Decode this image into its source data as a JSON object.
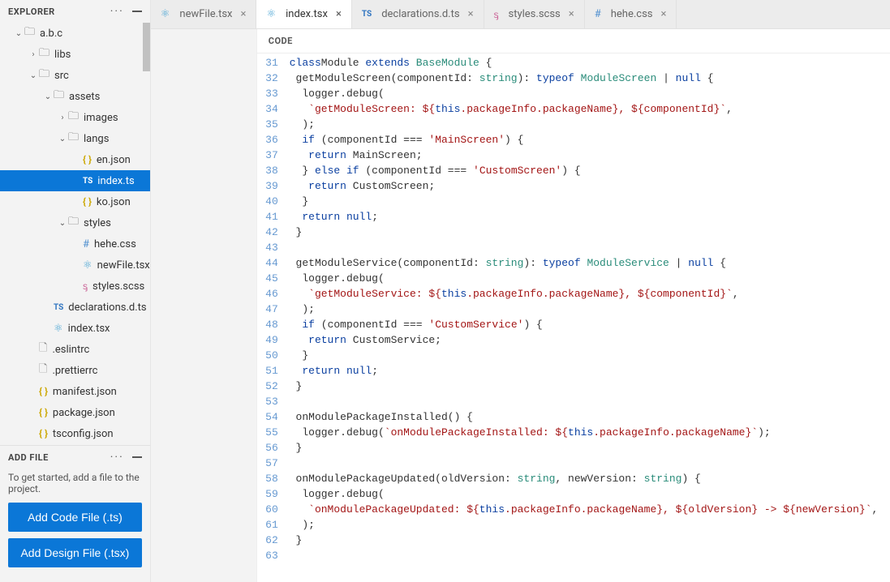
{
  "sidebar": {
    "title": "EXPLORER",
    "tree": [
      {
        "depth": 0,
        "chev": "down",
        "icon": "folder",
        "label": "a.b.c"
      },
      {
        "depth": 1,
        "chev": "right",
        "icon": "folder",
        "label": "libs"
      },
      {
        "depth": 1,
        "chev": "down",
        "icon": "folder",
        "label": "src"
      },
      {
        "depth": 2,
        "chev": "down",
        "icon": "folder",
        "label": "assets"
      },
      {
        "depth": 3,
        "chev": "right",
        "icon": "folder",
        "label": "images"
      },
      {
        "depth": 3,
        "chev": "down",
        "icon": "folder",
        "label": "langs"
      },
      {
        "depth": 4,
        "chev": "",
        "icon": "json",
        "label": "en.json"
      },
      {
        "depth": 4,
        "chev": "",
        "icon": "ts",
        "label": "index.ts",
        "selected": true
      },
      {
        "depth": 4,
        "chev": "",
        "icon": "json",
        "label": "ko.json"
      },
      {
        "depth": 3,
        "chev": "down",
        "icon": "folder",
        "label": "styles"
      },
      {
        "depth": 4,
        "chev": "",
        "icon": "hash",
        "label": "hehe.css"
      },
      {
        "depth": 4,
        "chev": "",
        "icon": "react",
        "label": "newFile.tsx"
      },
      {
        "depth": 4,
        "chev": "",
        "icon": "scss",
        "label": "styles.scss"
      },
      {
        "depth": 2,
        "chev": "",
        "icon": "ts",
        "label": "declarations.d.ts"
      },
      {
        "depth": 2,
        "chev": "",
        "icon": "react",
        "label": "index.tsx"
      },
      {
        "depth": 1,
        "chev": "",
        "icon": "file",
        "label": ".eslintrc"
      },
      {
        "depth": 1,
        "chev": "",
        "icon": "file",
        "label": ".prettierrc"
      },
      {
        "depth": 1,
        "chev": "",
        "icon": "json",
        "label": "manifest.json"
      },
      {
        "depth": 1,
        "chev": "",
        "icon": "json",
        "label": "package.json"
      },
      {
        "depth": 1,
        "chev": "",
        "icon": "json",
        "label": "tsconfig.json"
      }
    ],
    "addFile": {
      "title": "ADD FILE",
      "hint": "To get started, add a file to the project.",
      "codeBtn": "Add Code File (.ts)",
      "designBtn": "Add Design File (.tsx)"
    }
  },
  "tabs": [
    {
      "icon": "react",
      "label": "newFile.tsx",
      "active": false
    },
    {
      "icon": "react",
      "label": "index.tsx",
      "active": true
    },
    {
      "icon": "ts",
      "label": "declarations.d.ts",
      "active": false
    },
    {
      "icon": "scss",
      "label": "styles.scss",
      "active": false
    },
    {
      "icon": "hash",
      "label": "hehe.css",
      "active": false
    }
  ],
  "editor": {
    "header": "CODE",
    "startLine": 31,
    "lines": [
      [
        [
          "kw",
          "class"
        ],
        [
          "",
          ""
        ],
        [
          "",
          "Module "
        ],
        [
          "kw",
          "extends"
        ],
        [
          "",
          " "
        ],
        [
          "type",
          "BaseModule"
        ],
        [
          "",
          " {"
        ]
      ],
      [
        [
          "",
          " getModuleScreen(componentId: "
        ],
        [
          "type",
          "string"
        ],
        [
          "",
          "): "
        ],
        [
          "kw",
          "typeof"
        ],
        [
          "",
          " "
        ],
        [
          "type",
          "ModuleScreen"
        ],
        [
          "",
          " | "
        ],
        [
          "null",
          "null"
        ],
        [
          "",
          " {"
        ]
      ],
      [
        [
          "",
          "  logger.debug("
        ]
      ],
      [
        [
          "",
          "   "
        ],
        [
          "str",
          "`getModuleScreen: ${"
        ],
        [
          "this",
          "this"
        ],
        [
          "str",
          ".packageInfo.packageName}, ${componentId}`"
        ],
        [
          "",
          ","
        ]
      ],
      [
        [
          "",
          "  );"
        ]
      ],
      [
        [
          "",
          "  "
        ],
        [
          "kw",
          "if"
        ],
        [
          "",
          " (componentId === "
        ],
        [
          "str",
          "'MainScreen'"
        ],
        [
          "",
          ") {"
        ]
      ],
      [
        [
          "",
          "   "
        ],
        [
          "kw",
          "return"
        ],
        [
          "",
          " MainScreen;"
        ]
      ],
      [
        [
          "",
          "  } "
        ],
        [
          "kw",
          "else if"
        ],
        [
          "",
          " (componentId === "
        ],
        [
          "str",
          "'CustomScreen'"
        ],
        [
          "",
          ") {"
        ]
      ],
      [
        [
          "",
          "   "
        ],
        [
          "kw",
          "return"
        ],
        [
          "",
          " CustomScreen;"
        ]
      ],
      [
        [
          "",
          "  }"
        ]
      ],
      [
        [
          "",
          "  "
        ],
        [
          "kw",
          "return"
        ],
        [
          "",
          " "
        ],
        [
          "null",
          "null"
        ],
        [
          "",
          ";"
        ]
      ],
      [
        [
          "",
          " }"
        ]
      ],
      [
        [
          "",
          ""
        ]
      ],
      [
        [
          "",
          " getModuleService(componentId: "
        ],
        [
          "type",
          "string"
        ],
        [
          "",
          "): "
        ],
        [
          "kw",
          "typeof"
        ],
        [
          "",
          " "
        ],
        [
          "type",
          "ModuleService"
        ],
        [
          "",
          " | "
        ],
        [
          "null",
          "null"
        ],
        [
          "",
          " {"
        ]
      ],
      [
        [
          "",
          "  logger.debug("
        ]
      ],
      [
        [
          "",
          "   "
        ],
        [
          "str",
          "`getModuleService: ${"
        ],
        [
          "this",
          "this"
        ],
        [
          "str",
          ".packageInfo.packageName}, ${componentId}`"
        ],
        [
          "",
          ","
        ]
      ],
      [
        [
          "",
          "  );"
        ]
      ],
      [
        [
          "",
          "  "
        ],
        [
          "kw",
          "if"
        ],
        [
          "",
          " (componentId === "
        ],
        [
          "str",
          "'CustomService'"
        ],
        [
          "",
          ") {"
        ]
      ],
      [
        [
          "",
          "   "
        ],
        [
          "kw",
          "return"
        ],
        [
          "",
          " CustomService;"
        ]
      ],
      [
        [
          "",
          "  }"
        ]
      ],
      [
        [
          "",
          "  "
        ],
        [
          "kw",
          "return"
        ],
        [
          "",
          " "
        ],
        [
          "null",
          "null"
        ],
        [
          "",
          ";"
        ]
      ],
      [
        [
          "",
          " }"
        ]
      ],
      [
        [
          "",
          ""
        ]
      ],
      [
        [
          "",
          " onModulePackageInstalled() {"
        ]
      ],
      [
        [
          "",
          "  logger.debug("
        ],
        [
          "str",
          "`onModulePackageInstalled: ${"
        ],
        [
          "this",
          "this"
        ],
        [
          "str",
          ".packageInfo.packageName}`"
        ],
        [
          "",
          ");"
        ]
      ],
      [
        [
          "",
          " }"
        ]
      ],
      [
        [
          "",
          ""
        ]
      ],
      [
        [
          "",
          " onModulePackageUpdated(oldVersion: "
        ],
        [
          "type",
          "string"
        ],
        [
          "",
          ", newVersion: "
        ],
        [
          "type",
          "string"
        ],
        [
          "",
          ") {"
        ]
      ],
      [
        [
          "",
          "  logger.debug("
        ]
      ],
      [
        [
          "",
          "   "
        ],
        [
          "str",
          "`onModulePackageUpdated: ${"
        ],
        [
          "this",
          "this"
        ],
        [
          "str",
          ".packageInfo.packageName}, ${oldVersion} -> ${newVersion}`"
        ],
        [
          "",
          ","
        ]
      ],
      [
        [
          "",
          "  );"
        ]
      ],
      [
        [
          "",
          " }"
        ]
      ],
      [
        [
          "",
          ""
        ]
      ]
    ]
  }
}
